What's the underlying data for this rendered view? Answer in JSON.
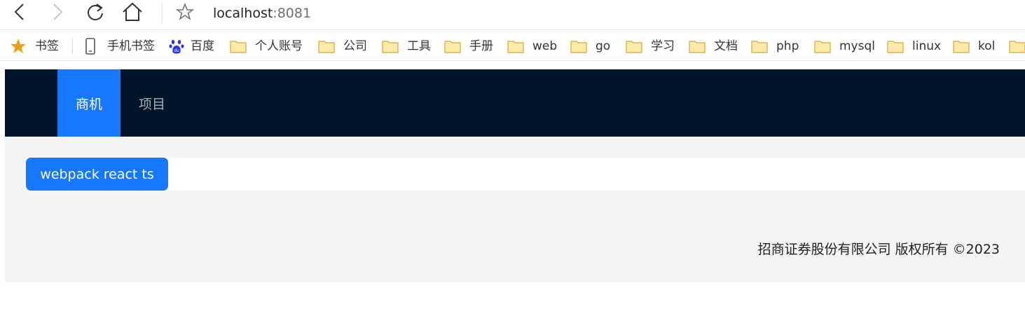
{
  "browser": {
    "url_host": "localhost",
    "url_port": ":8081",
    "icons": [
      "back-icon",
      "forward-icon",
      "reload-icon",
      "home-icon",
      "star-outline-icon"
    ]
  },
  "bookmarks": {
    "items": [
      {
        "label": "书签",
        "icon": "star-icon"
      },
      {
        "label": "手机书签",
        "icon": "phone-icon"
      },
      {
        "label": "百度",
        "icon": "baidu-paw-icon"
      },
      {
        "label": "个人账号",
        "icon": "folder-icon"
      },
      {
        "label": "公司",
        "icon": "folder-icon"
      },
      {
        "label": "工具",
        "icon": "folder-icon"
      },
      {
        "label": "手册",
        "icon": "folder-icon"
      },
      {
        "label": "web",
        "icon": "folder-icon"
      },
      {
        "label": "go",
        "icon": "folder-icon"
      },
      {
        "label": "学习",
        "icon": "folder-icon"
      },
      {
        "label": "文档",
        "icon": "folder-icon"
      },
      {
        "label": "php",
        "icon": "folder-icon"
      },
      {
        "label": "mysql",
        "icon": "folder-icon"
      },
      {
        "label": "linux",
        "icon": "folder-icon"
      },
      {
        "label": "kol",
        "icon": "folder-icon"
      }
    ]
  },
  "header": {
    "nav": [
      {
        "label": "商机",
        "active": true
      },
      {
        "label": "项目",
        "active": false
      }
    ]
  },
  "content": {
    "tab_label": "webpack react ts"
  },
  "footer": {
    "text": "招商证券股份有限公司 版权所有 ©2023"
  },
  "colors": {
    "header_bg": "#001529",
    "accent": "#1677ff",
    "content_bg": "#f4f4f4",
    "folder": "#f5d47a",
    "star": "#f29d0f",
    "baidu": "#2932e1"
  }
}
